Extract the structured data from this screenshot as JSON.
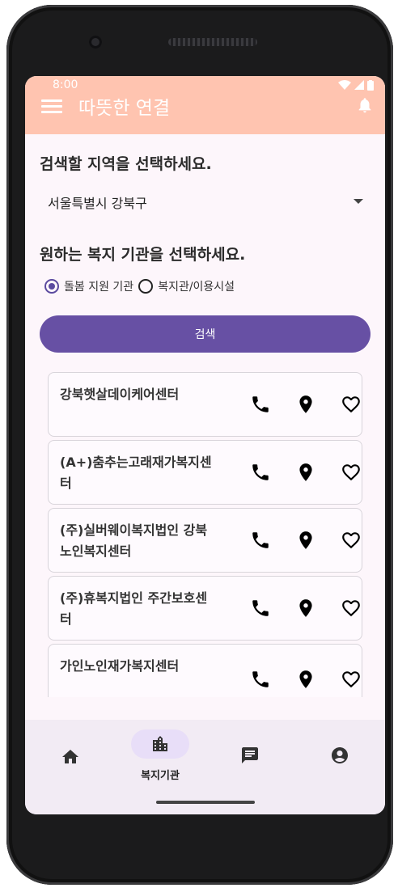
{
  "status_bar": {
    "time": "8:00"
  },
  "app_bar": {
    "title": "따뜻한 연결"
  },
  "region": {
    "prompt": "검색할 지역을 선택하세요.",
    "selected": "서울특별시 강북구"
  },
  "facility": {
    "prompt": "원하는 복지 기관을 선택하세요.",
    "options": [
      {
        "label": "돌봄 지원 기관",
        "checked": true
      },
      {
        "label": "복지관/이용시설",
        "checked": false
      }
    ]
  },
  "search_button": {
    "label": "검색"
  },
  "results": [
    {
      "name": "강북햇살데이케어센터"
    },
    {
      "name": "(A+)춤추는고래재가복지센터"
    },
    {
      "name": "(주)실버웨이복지법인 강북노인복지센터"
    },
    {
      "name": "(주)휴복지법인 주간보호센터"
    },
    {
      "name": "가인노인재가복지센터"
    }
  ],
  "bottom_nav": {
    "items": [
      {
        "icon": "home-icon",
        "label": ""
      },
      {
        "icon": "building-icon",
        "label": "복지기관",
        "selected": true
      },
      {
        "icon": "chat-icon",
        "label": ""
      },
      {
        "icon": "account-icon",
        "label": ""
      }
    ]
  },
  "colors": {
    "app_bar": "#ffc4b0",
    "primary": "#6750a4",
    "nav_selected": "#e8def8",
    "background": "#fdf6fb"
  }
}
